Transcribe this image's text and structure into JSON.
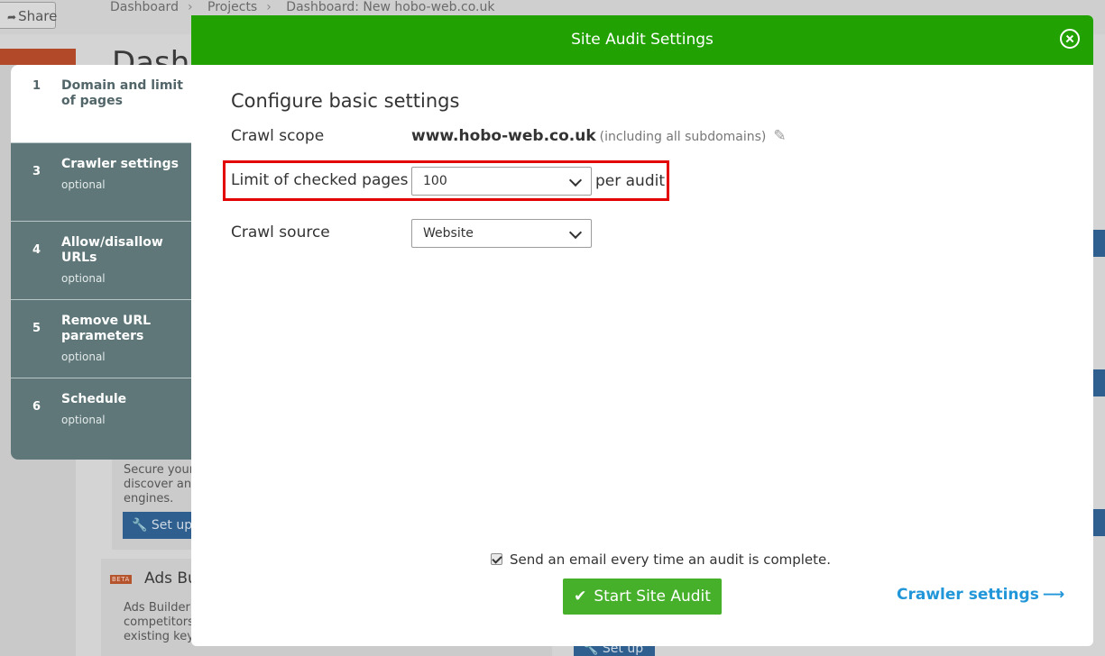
{
  "background": {
    "share_label": "Share",
    "breadcrumbs": [
      "Dashboard",
      "Projects",
      "Dashboard: New hobo-web.co.uk"
    ],
    "page_title": "Dashb",
    "card1_text": [
      "Secure your",
      "discover and",
      "engines."
    ],
    "setup_label": "Set up",
    "beta_badge": "BETA",
    "ads_title": "Ads Bu",
    "ads_text": [
      "Ads Builder",
      "competitors",
      "existing key"
    ]
  },
  "steps": [
    {
      "num": "1",
      "label": "Domain and limit of pages",
      "sub": ""
    },
    {
      "num": "3",
      "label": "Crawler settings",
      "sub": "optional"
    },
    {
      "num": "4",
      "label": "Allow/disallow URLs",
      "sub": "optional"
    },
    {
      "num": "5",
      "label": "Remove URL parameters",
      "sub": "optional"
    },
    {
      "num": "6",
      "label": "Schedule",
      "sub": "optional"
    }
  ],
  "modal": {
    "title": "Site Audit Settings",
    "section_title": "Configure basic settings",
    "crawl_scope": {
      "label": "Crawl scope",
      "domain": "www.hobo-web.co.uk",
      "note": "(including all subdomains)"
    },
    "limit": {
      "label": "Limit of checked pages",
      "value": "100",
      "suffix": "per audit"
    },
    "source": {
      "label": "Crawl source",
      "value": "Website"
    },
    "email_notice": "Send an email every time an audit is complete.",
    "email_checked": true,
    "start_button": "Start Site Audit",
    "crawler_link": "Crawler settings"
  },
  "colors": {
    "header_green": "#21a102",
    "button_green": "#46b02a",
    "link_blue": "#2196d8",
    "highlight_red": "#e30000",
    "sidebar_slate": "#5f7779"
  }
}
